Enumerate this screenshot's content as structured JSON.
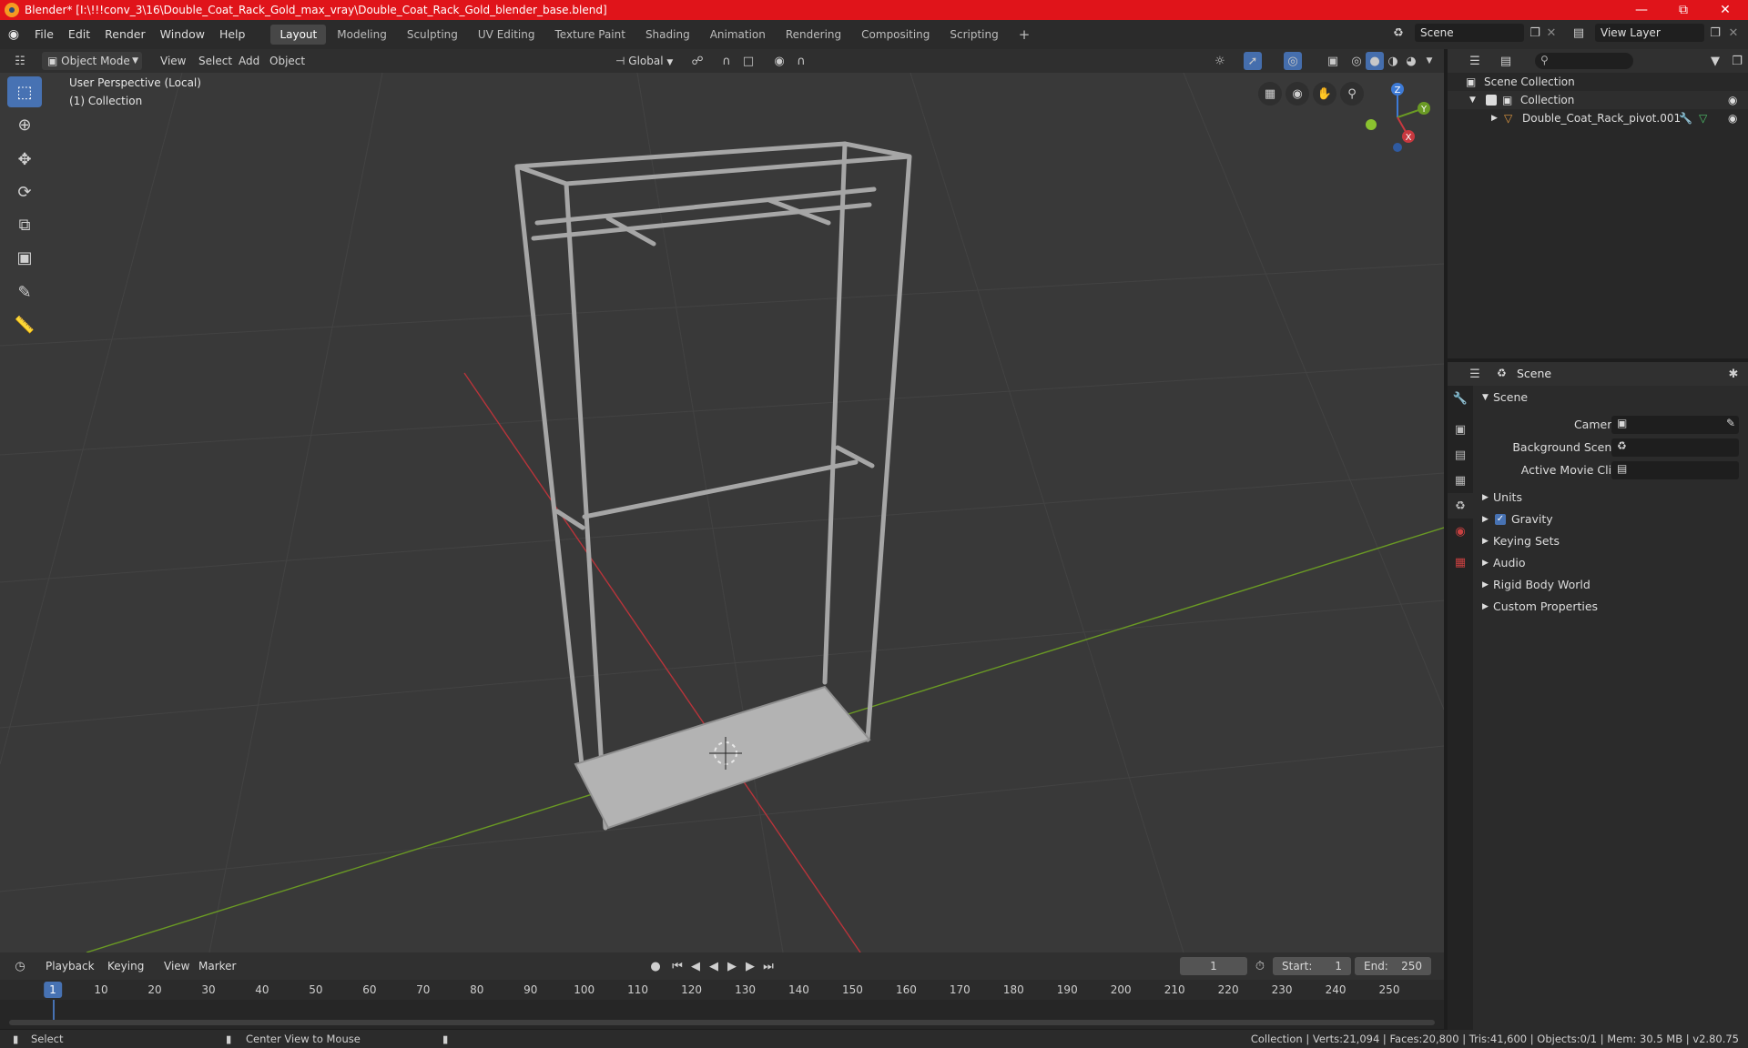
{
  "window": {
    "title": "Blender* [I:\\!!!conv_3\\16\\Double_Coat_Rack_Gold_max_vray\\Double_Coat_Rack_Gold_blender_base.blend]"
  },
  "menu": {
    "items": [
      "File",
      "Edit",
      "Render",
      "Window",
      "Help"
    ]
  },
  "workspaces": {
    "tabs": [
      "Layout",
      "Modeling",
      "Sculpting",
      "UV Editing",
      "Texture Paint",
      "Shading",
      "Animation",
      "Rendering",
      "Compositing",
      "Scripting"
    ],
    "active": "Layout"
  },
  "scene_selector": {
    "value": "Scene"
  },
  "view_layer": {
    "value": "View Layer"
  },
  "viewport_header": {
    "mode": "Object Mode",
    "menus": [
      "View",
      "Select",
      "Add",
      "Object"
    ],
    "transform_orientation": "Global"
  },
  "viewport": {
    "perspective_label": "User Perspective (Local)",
    "collection_label": "(1) Collection",
    "gizmo_axes": [
      "X",
      "Y",
      "Z"
    ]
  },
  "outliner": {
    "root": "Scene Collection",
    "collection": "Collection",
    "object": "Double_Coat_Rack_pivot.001"
  },
  "properties": {
    "header": "Scene",
    "panel": "Scene",
    "fields": [
      {
        "label": "Camera"
      },
      {
        "label": "Background Scene"
      },
      {
        "label": "Active Movie Clip"
      }
    ],
    "sections": [
      "Units",
      "Gravity",
      "Keying Sets",
      "Audio",
      "Rigid Body World",
      "Custom Properties"
    ],
    "gravity_checked": true
  },
  "timeline": {
    "menus": [
      "Playback",
      "Keying",
      "View",
      "Marker"
    ],
    "current_frame": "1",
    "start_label": "Start:",
    "start_value": "1",
    "end_label": "End:",
    "end_value": "250",
    "ruler": [
      "1",
      "10",
      "20",
      "30",
      "40",
      "50",
      "60",
      "70",
      "80",
      "90",
      "100",
      "110",
      "120",
      "130",
      "140",
      "150",
      "160",
      "170",
      "180",
      "190",
      "200",
      "210",
      "220",
      "230",
      "240",
      "250"
    ]
  },
  "status_bar": {
    "select": "Select",
    "center_view": "Center View to Mouse",
    "stats": "Collection | Verts:21,094 | Faces:20,800 | Tris:41,600 | Objects:0/1 | Mem: 30.5 MB | v2.80.75"
  },
  "colors": {
    "title_bar": "#e0141a",
    "accent": "#4772b3",
    "x_axis": "#c8383f",
    "y_axis": "#6a9a24",
    "z_axis": "#3d7ad6"
  }
}
